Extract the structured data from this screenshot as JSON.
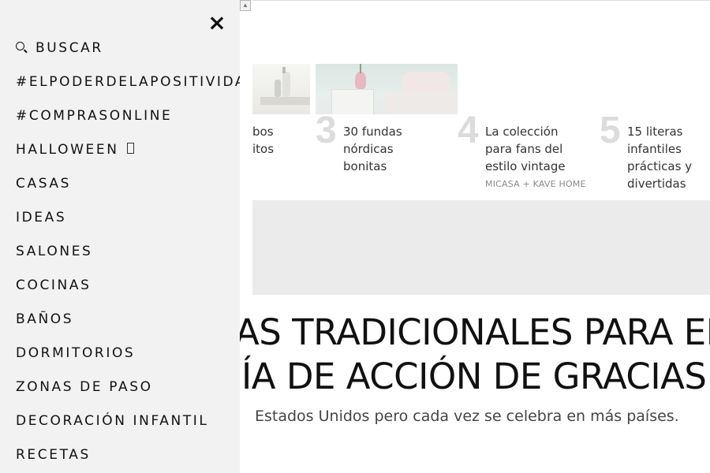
{
  "menu": {
    "close_label": "×",
    "items": [
      {
        "label": "BUSCAR",
        "icon": "search-icon"
      },
      {
        "label": "#ELPODERDELAPOSITIVIDAD"
      },
      {
        "label": "#COMPRASONLINE"
      },
      {
        "label": "HALLOWEEN",
        "icon": "pumpkin-icon"
      },
      {
        "label": "CASAS"
      },
      {
        "label": "IDEAS"
      },
      {
        "label": "SALONES"
      },
      {
        "label": "COCINAS"
      },
      {
        "label": "BAÑOS"
      },
      {
        "label": "DORMITORIOS"
      },
      {
        "label": "ZONAS DE PASO"
      },
      {
        "label": "DECORACIÓN INFANTIL"
      },
      {
        "label": "RECETAS"
      }
    ]
  },
  "cards": [
    {
      "number": "",
      "title": "bos\nitos",
      "brand": ""
    },
    {
      "number": "3",
      "title": "30 fundas nórdicas bonitas",
      "brand": ""
    },
    {
      "number": "4",
      "title": "La colección para fans del estilo vintage",
      "brand": "MICASA + KAVE HOME"
    },
    {
      "number": "5",
      "title": "15 literas infantiles prácticas y divertidas",
      "brand": ""
    }
  ],
  "article": {
    "headline_line1": "AS TRADICIONALES PARA EL",
    "headline_line2": "ÍA DE ACCIÓN DE GRACIAS",
    "subtitle": "Estados Unidos pero cada vez se celebra en más países."
  },
  "colors": {
    "menu_bg": "#f2f2f2",
    "ad_band": "#ebebeb",
    "number_grey": "#dcdcdc"
  }
}
